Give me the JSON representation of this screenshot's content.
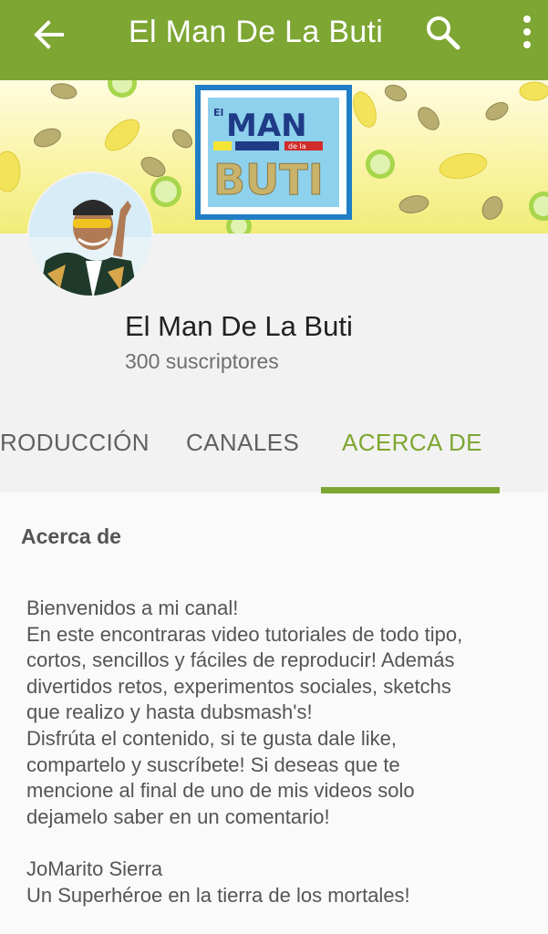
{
  "appbar": {
    "title": "El Man De La Buti",
    "back_icon": "arrow-left-icon",
    "search_icon": "search-icon",
    "more_icon": "more-vert-icon",
    "color": "#7da632"
  },
  "banner": {
    "logo_text": {
      "line1_small": "El",
      "line1": "MAN",
      "middle": "de la",
      "line2": "BUTI"
    }
  },
  "channel": {
    "name": "El Man De La Buti",
    "subscribers": "300 suscriptores"
  },
  "tabs": [
    {
      "label": "RODUCCIÓN",
      "active": false
    },
    {
      "label": "CANALES",
      "active": false
    },
    {
      "label": "ACERCA DE",
      "active": true
    }
  ],
  "about": {
    "title": "Acerca de",
    "lines": [
      "Bienvenidos a mi canal!",
      "En este encontraras video tutoriales de todo tipo,",
      "cortos, sencillos y fáciles de reproducir! Además",
      "divertidos retos, experimentos sociales, sketchs",
      "que realizo y hasta dubsmash's!",
      "Disfrúta el contenido, si te gusta dale like,",
      "compartelo y suscríbete! Si deseas que te",
      "mencione al final de uno de mis videos solo",
      "dejamelo saber en un comentario!",
      "",
      "JoMarito Sierra",
      "Un Superhéroe en la tierra de los mortales!"
    ]
  }
}
